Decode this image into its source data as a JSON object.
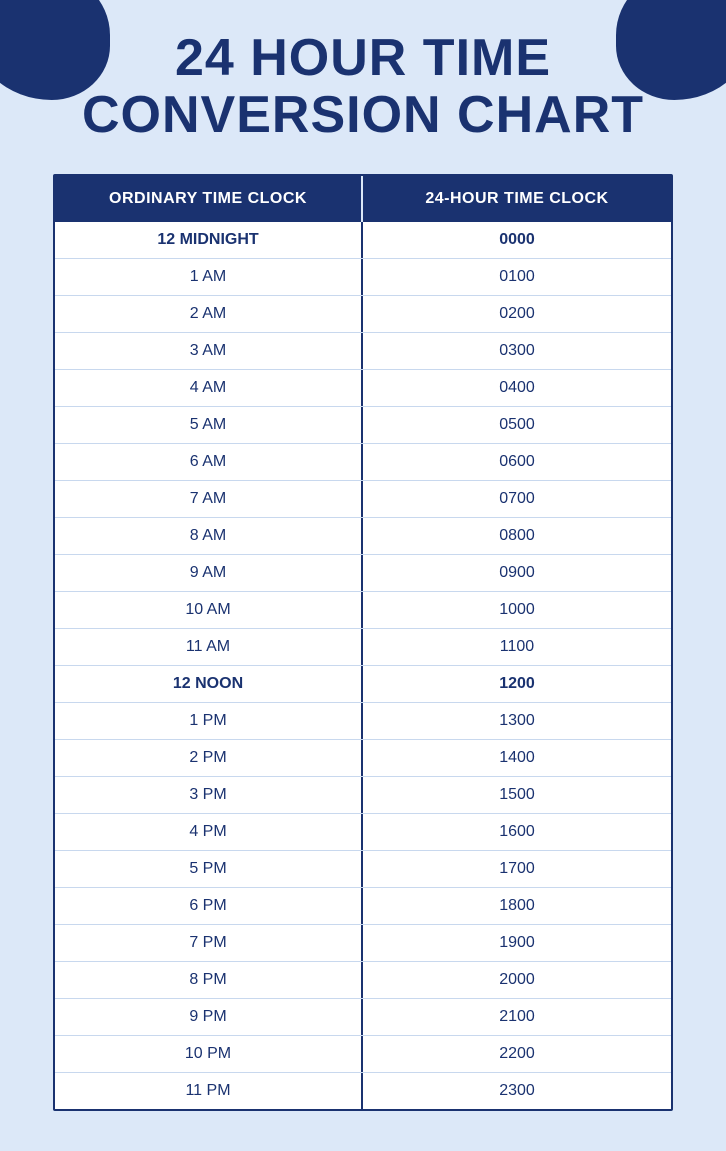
{
  "page": {
    "background_color": "#dce8f8",
    "title_line1": "24 HOUR TIME",
    "title_line2": "CONVERSION CHART"
  },
  "table": {
    "col1_header": "ORDINARY TIME CLOCK",
    "col2_header": "24-HOUR TIME CLOCK",
    "rows": [
      {
        "ordinary": "12 MIDNIGHT",
        "military": "0000",
        "special": true
      },
      {
        "ordinary": "1 AM",
        "military": "0100",
        "special": false
      },
      {
        "ordinary": "2 AM",
        "military": "0200",
        "special": false
      },
      {
        "ordinary": "3 AM",
        "military": "0300",
        "special": false
      },
      {
        "ordinary": "4 AM",
        "military": "0400",
        "special": false
      },
      {
        "ordinary": "5 AM",
        "military": "0500",
        "special": false
      },
      {
        "ordinary": "6 AM",
        "military": "0600",
        "special": false
      },
      {
        "ordinary": "7 AM",
        "military": "0700",
        "special": false
      },
      {
        "ordinary": "8 AM",
        "military": "0800",
        "special": false
      },
      {
        "ordinary": "9 AM",
        "military": "0900",
        "special": false
      },
      {
        "ordinary": "10 AM",
        "military": "1000",
        "special": false
      },
      {
        "ordinary": "11 AM",
        "military": "1100",
        "special": false
      },
      {
        "ordinary": "12 NOON",
        "military": "1200",
        "special": true
      },
      {
        "ordinary": "1 PM",
        "military": "1300",
        "special": false
      },
      {
        "ordinary": "2 PM",
        "military": "1400",
        "special": false
      },
      {
        "ordinary": "3 PM",
        "military": "1500",
        "special": false
      },
      {
        "ordinary": "4 PM",
        "military": "1600",
        "special": false
      },
      {
        "ordinary": "5 PM",
        "military": "1700",
        "special": false
      },
      {
        "ordinary": "6 PM",
        "military": "1800",
        "special": false
      },
      {
        "ordinary": "7 PM",
        "military": "1900",
        "special": false
      },
      {
        "ordinary": "8 PM",
        "military": "2000",
        "special": false
      },
      {
        "ordinary": "9 PM",
        "military": "2100",
        "special": false
      },
      {
        "ordinary": "10 PM",
        "military": "2200",
        "special": false
      },
      {
        "ordinary": "11 PM",
        "military": "2300",
        "special": false
      }
    ]
  }
}
